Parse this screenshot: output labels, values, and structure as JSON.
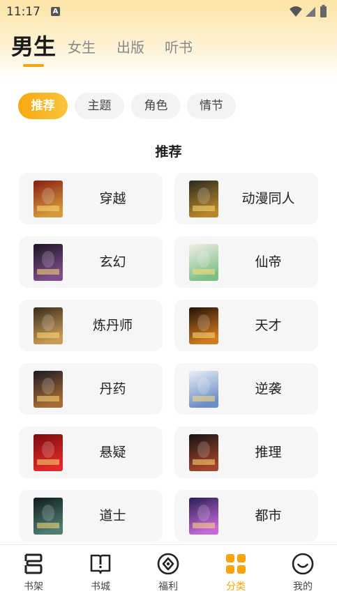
{
  "status_bar": {
    "time": "11:17",
    "notification_icon": "a-icon",
    "icons": [
      "wifi-icon",
      "signal-icon",
      "battery-icon"
    ]
  },
  "top_tabs": [
    {
      "label": "男生",
      "active": true
    },
    {
      "label": "女生",
      "active": false
    },
    {
      "label": "出版",
      "active": false
    },
    {
      "label": "听书",
      "active": false
    }
  ],
  "filter_chips": [
    {
      "label": "推荐",
      "active": true
    },
    {
      "label": "主题",
      "active": false
    },
    {
      "label": "角色",
      "active": false
    },
    {
      "label": "情节",
      "active": false
    }
  ],
  "section_title": "推荐",
  "categories": [
    {
      "label": "穿越",
      "cover_colors": [
        "#8a1d14",
        "#d49a3a"
      ]
    },
    {
      "label": "动漫同人",
      "cover_colors": [
        "#2a2a1e",
        "#b7862c"
      ]
    },
    {
      "label": "玄幻",
      "cover_colors": [
        "#1b1426",
        "#7d4d88"
      ]
    },
    {
      "label": "仙帝",
      "cover_colors": [
        "#f3eee8",
        "#7bbf85"
      ]
    },
    {
      "label": "炼丹师",
      "cover_colors": [
        "#3a2b1c",
        "#c79b55"
      ]
    },
    {
      "label": "天才",
      "cover_colors": [
        "#231107",
        "#d07a1f"
      ]
    },
    {
      "label": "丹药",
      "cover_colors": [
        "#1d1a22",
        "#a66c36"
      ]
    },
    {
      "label": "逆袭",
      "cover_colors": [
        "#e9eef6",
        "#6b8cc4"
      ]
    },
    {
      "label": "悬疑",
      "cover_colors": [
        "#7a0b0b",
        "#e02a2a"
      ]
    },
    {
      "label": "推理",
      "cover_colors": [
        "#151313",
        "#a2432b"
      ]
    },
    {
      "label": "道士",
      "cover_colors": [
        "#0f1a1c",
        "#4f7d73"
      ]
    },
    {
      "label": "都市",
      "cover_colors": [
        "#2a1d55",
        "#c569d8"
      ]
    }
  ],
  "bottom_nav": [
    {
      "label": "书架",
      "icon": "bookshelf-icon",
      "active": false
    },
    {
      "label": "书城",
      "icon": "book-icon",
      "active": false
    },
    {
      "label": "福利",
      "icon": "gift-circle-icon",
      "active": false
    },
    {
      "label": "分类",
      "icon": "grid-icon",
      "active": true
    },
    {
      "label": "我的",
      "icon": "smile-icon",
      "active": false
    }
  ],
  "colors": {
    "accent": "#f5a50a",
    "header_top": "#fde4a6",
    "card_bg": "#f6f6f6",
    "chip_bg": "#f3f3f3"
  }
}
